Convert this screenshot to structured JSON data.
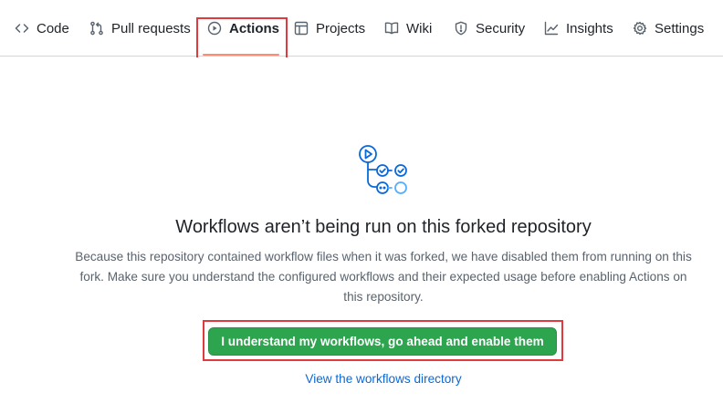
{
  "nav": {
    "tabs": [
      {
        "label": "Code",
        "icon": "code-icon"
      },
      {
        "label": "Pull requests",
        "icon": "git-pull-request-icon"
      },
      {
        "label": "Actions",
        "icon": "play-circle-icon",
        "active": true
      },
      {
        "label": "Projects",
        "icon": "table-icon"
      },
      {
        "label": "Wiki",
        "icon": "book-icon"
      },
      {
        "label": "Security",
        "icon": "shield-icon"
      },
      {
        "label": "Insights",
        "icon": "graph-icon"
      },
      {
        "label": "Settings",
        "icon": "gear-icon"
      }
    ]
  },
  "notice": {
    "heading": "Workflows aren’t being run on this forked repository",
    "description": "Because this repository contained workflow files when it was forked, we have disabled them from running on this fork. Make sure you understand the configured workflows and their expected usage before enabling Actions on this repository.",
    "enable_button": "I understand my workflows, go ahead and enable them",
    "directory_link": "View the workflows directory"
  },
  "colors": {
    "accent_underline": "#fd8c73",
    "highlight_box": "#e0393e",
    "primary_button": "#2da44e",
    "link": "#0969da",
    "illustration": "#0969da"
  }
}
